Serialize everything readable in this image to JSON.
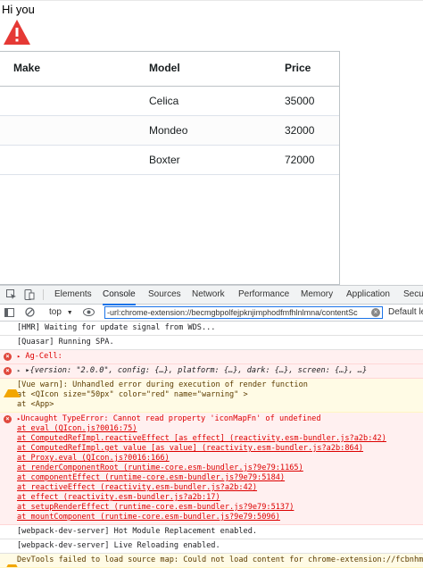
{
  "page": {
    "greeting": "Hi you"
  },
  "grid": {
    "columns": [
      "Make",
      "Model",
      "Price"
    ],
    "rows": [
      {
        "make": "",
        "model": "Celica",
        "price": "35000"
      },
      {
        "make": "",
        "model": "Mondeo",
        "price": "32000"
      },
      {
        "make": "",
        "model": "Boxter",
        "price": "72000"
      }
    ]
  },
  "devtools": {
    "tabs": [
      "Elements",
      "Console",
      "Sources",
      "Network",
      "Performance",
      "Memory",
      "Application",
      "Secu"
    ],
    "active_tab": "Console",
    "context": "top",
    "filter_value": "-url:chrome-extension://becmgbpolfejpknjimphodfmfhlnlmna/contentSc",
    "levels": "Default le",
    "messages": [
      {
        "type": "log",
        "text": "[HMR] Waiting for update signal from WDS..."
      },
      {
        "type": "log",
        "text": "[Quasar] Running SPA."
      },
      {
        "type": "error",
        "text": "Ag-Cell:"
      },
      {
        "type": "error-obj",
        "text": "▸{version: \"2.0.0\", config: {…}, platform: {…}, dark: {…}, screen: {…}, …}"
      },
      {
        "type": "warn",
        "lines": [
          "[Vue warn]: Unhandled error during execution of render function",
          "  at <QIcon size=\"50px\" color=\"red\" name=\"warning\" >",
          "  at <App>"
        ]
      },
      {
        "type": "error-stack",
        "lines": [
          "Uncaught TypeError: Cannot read property 'iconMapFn' of undefined",
          "    at eval (QIcon.js?0016:75)",
          "    at ComputedRefImpl.reactiveEffect [as effect] (reactivity.esm-bundler.js?a2b:42)",
          "    at ComputedRefImpl.get value [as value] (reactivity.esm-bundler.js?a2b:864)",
          "    at Proxy.eval (QIcon.js?0016:166)",
          "    at renderComponentRoot (runtime-core.esm-bundler.js?9e79:1165)",
          "    at componentEffect (runtime-core.esm-bundler.js?9e79:5184)",
          "    at reactiveEffect (reactivity.esm-bundler.js?a2b:42)",
          "    at effect (reactivity.esm-bundler.js?a2b:17)",
          "    at setupRenderEffect (runtime-core.esm-bundler.js?9e79:5137)",
          "    at mountComponent (runtime-core.esm-bundler.js?9e79:5096)"
        ]
      },
      {
        "type": "log",
        "text": "[webpack-dev-server] Hot Module Replacement enabled."
      },
      {
        "type": "log",
        "text": "[webpack-dev-server] Live Reloading enabled."
      },
      {
        "type": "warn",
        "lines": [
          "DevTools failed to load source map: Could not load content for chrome-extension://fcbnhmal"
        ]
      }
    ]
  },
  "colors": {
    "warning_icon": "#e53935",
    "error_text": "#dd0000",
    "accent": "#1a73e8"
  }
}
